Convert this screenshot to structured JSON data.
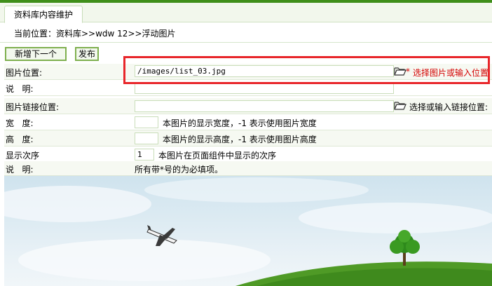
{
  "tab": {
    "label": "资料库内容维护"
  },
  "breadcrumb": {
    "text": "当前位置：资料库>>wdw 12>>浮动图片"
  },
  "toolbar": {
    "new_label": "新增下一个",
    "publish_label": "发布"
  },
  "form": {
    "image_position": {
      "label": "图片位置:",
      "value": "/images/list_03.jpg",
      "required": "*",
      "hint": "选择图片或输入位置"
    },
    "description": {
      "label": "说   明:",
      "value": ""
    },
    "link_position": {
      "label": "图片链接位置:",
      "value": "",
      "hint": "选择或输入链接位置:"
    },
    "width": {
      "label": "宽   度:",
      "value": "",
      "hint": "本图片的显示宽度，-1 表示使用图片宽度"
    },
    "height": {
      "label": "高   度:",
      "value": "",
      "hint": "本图片的显示高度，-1 表示使用图片高度"
    },
    "order": {
      "label": "显示次序",
      "value": "1",
      "hint": "本图片在页面组件中显示的次序"
    },
    "note": {
      "label": "说   明:",
      "text": "所有带*号的为必填项。"
    }
  },
  "icons": {
    "folder": "folder-open-icon",
    "airplane": "airplane-icon",
    "tree": "tree-icon"
  },
  "colors": {
    "accent": "#3f8f1a",
    "highlight": "#e8262a",
    "required": "#d40000"
  }
}
